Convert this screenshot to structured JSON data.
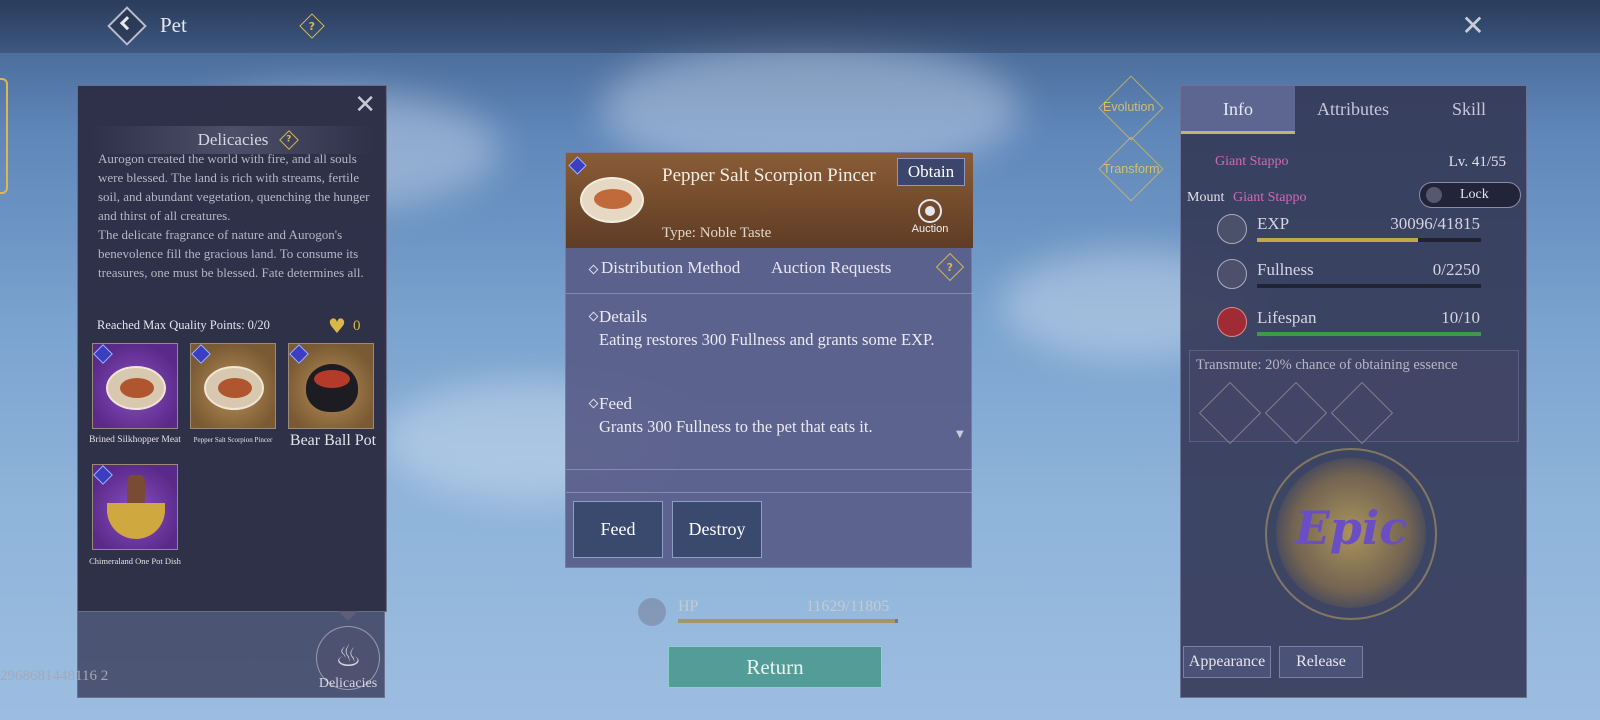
{
  "header": {
    "title": "Pet",
    "help_glyph": "?",
    "close_glyph": "✕"
  },
  "delicacies_popup": {
    "title": "Delicacies",
    "close_glyph": "✕",
    "description": [
      "Aurogon created the world with fire, and all souls were blessed. The land is rich with streams, fertile soil, and abundant vegetation, quenching the hunger and thirst of all creatures.",
      "The delicate fragrance of nature and Aurogon's benevolence fill the gracious land. To consume its treasures, one must be blessed. Fate determines all."
    ],
    "quality_points": "Reached Max Quality Points: 0/20",
    "heart_count": "0",
    "items": [
      {
        "name": "Brined Silkhopper Meat",
        "rarity_color": "#7a3fb0"
      },
      {
        "name": "Pepper Salt Scorpion Pincer",
        "rarity_color": "#a07a48"
      },
      {
        "name": "Bear Ball Pot",
        "rarity_color": "#a07a48"
      },
      {
        "name": "Chimeraland One Pot Dish",
        "rarity_color": "#7a3fb0"
      }
    ]
  },
  "player_id": "2968681448116 2",
  "delicacies_button": {
    "label": "Delicacies",
    "icon": "chef-icon"
  },
  "item_detail": {
    "name": "Pepper Salt Scorpion Pincer",
    "obtain_label": "Obtain",
    "type": "Type: Noble Taste",
    "auction_label": "Auction",
    "distribution_label": "Distribution Method",
    "distribution_value": "Auction Requests",
    "details_title": "Details",
    "details_body": "Eating restores 300 Fullness and grants some EXP.",
    "feed_title": "Feed",
    "feed_body": "Grants 300 Fullness to the pet that eats it.",
    "feed_button": "Feed",
    "destroy_button": "Destroy"
  },
  "hp": {
    "label": "HP",
    "value": "11629/11805",
    "fraction": 0.985
  },
  "return_button": "Return",
  "side_actions": {
    "evolution": "Evolution",
    "transform": "Transform"
  },
  "pet_panel": {
    "tabs": [
      "Info",
      "Attributes",
      "Skill"
    ],
    "active_tab": "Info",
    "pet_name": "Giant Stappo",
    "level": "Lv. 41/55",
    "mount_label": "Mount",
    "mount_name": "Giant Stappo",
    "lock_label": "Lock",
    "stats": [
      {
        "name": "EXP",
        "value": "30096/41815",
        "fraction": 0.72,
        "color": "#c0a848"
      },
      {
        "name": "Fullness",
        "value": "0/2250",
        "fraction": 0.0,
        "color": "#c0a848"
      },
      {
        "name": "Lifespan",
        "value": "10/10",
        "fraction": 1.0,
        "color": "#3e9a4a"
      }
    ],
    "transmute_text": "Transmute: 20% chance of obtaining essence",
    "rarity": "Epic",
    "appearance_button": "Appearance",
    "release_button": "Release"
  }
}
